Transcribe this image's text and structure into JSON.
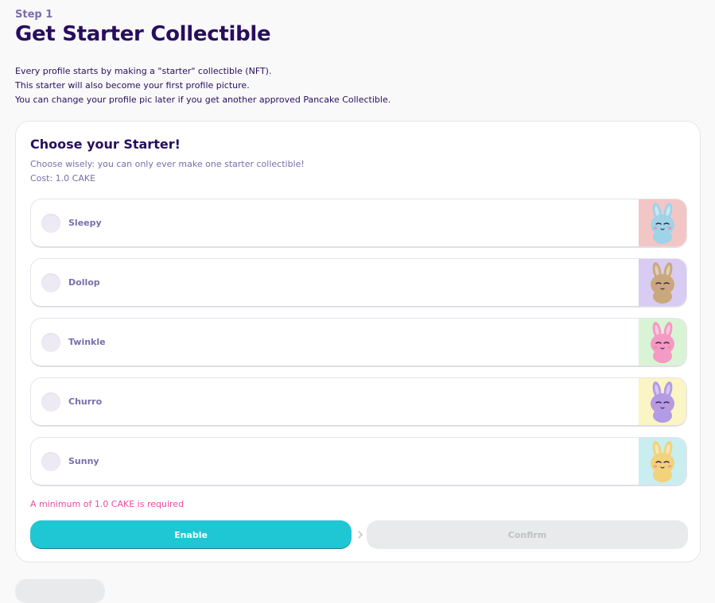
{
  "header": {
    "step": "Step 1",
    "title": "Get Starter Collectible",
    "intro": [
      "Every profile starts by making a \"starter\" collectible (NFT).",
      "This starter will also become your first profile picture.",
      "You can change your profile pic later if you get another approved Pancake Collectible."
    ]
  },
  "card": {
    "title": "Choose your Starter!",
    "subtitle": "Choose wisely: you can only ever make one starter collectible!",
    "cost": "Cost: 1.0 CAKE",
    "options": [
      {
        "label": "Sleepy",
        "bg": "#f3c6c6",
        "body": "#9fd3e8",
        "icon": "sleepy-bunny-icon"
      },
      {
        "label": "Dollop",
        "bg": "#d8ccf2",
        "body": "#c9a87c",
        "icon": "dollop-bunny-icon"
      },
      {
        "label": "Twinkle",
        "bg": "#d9f4d4",
        "body": "#f49ac4",
        "icon": "twinkle-bunny-icon"
      },
      {
        "label": "Churro",
        "bg": "#fbf4c4",
        "body": "#b39be6",
        "icon": "churro-bunny-icon"
      },
      {
        "label": "Sunny",
        "bg": "#c9eef0",
        "body": "#f2d27a",
        "icon": "sunny-bunny-icon"
      }
    ],
    "warning": "A minimum of 1.0 CAKE is required",
    "enable_label": "Enable",
    "confirm_label": "Confirm"
  },
  "colors": {
    "primary": "#1fc7d4",
    "text": "#280d5f",
    "text_subtle": "#7a6eaa",
    "failure": "#ed4b9e",
    "disabled": "#e9eaeb"
  }
}
